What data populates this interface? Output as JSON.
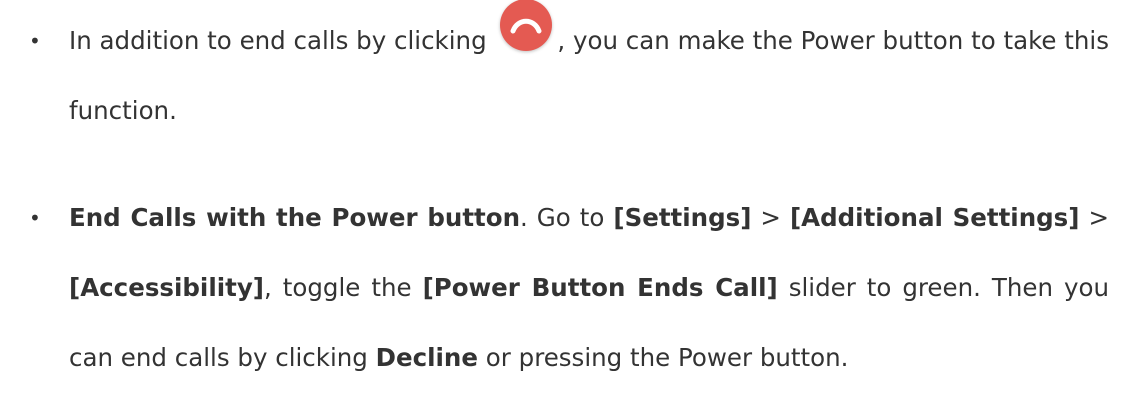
{
  "items": [
    {
      "text_before_icon": "In addition to end calls by clicking",
      "icon": "end-call-icon",
      "text_after_icon": ", you can make the Power button to take this function."
    },
    {
      "bold_title": "End Calls with the Power button",
      "text_go_to": ". Go to ",
      "settings": "[Settings]",
      "sep_1": " > ",
      "additional_settings": "[Additional Settings]",
      "sep_2": " > ",
      "accessibility": "[Accessibility]",
      "text_toggle": ", toggle the ",
      "power_button_ends_call": "[Power Button Ends Call]",
      "text_slider": " slider to green. Then you can end calls by clicking ",
      "decline": "Decline",
      "text_end": " or pressing the Power button."
    }
  ],
  "colors": {
    "text": "#333333",
    "end_call_icon": "#e45a52"
  }
}
